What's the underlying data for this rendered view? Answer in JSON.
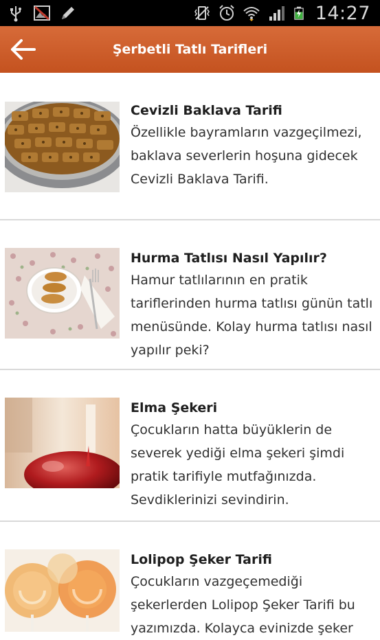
{
  "status_bar": {
    "left_icons": [
      "usb-icon",
      "blocked-image-icon",
      "pencil-icon"
    ],
    "right_icons": [
      "vibrate-icon",
      "alarm-icon",
      "wifi-icon",
      "signal-icon",
      "battery-charging-icon"
    ],
    "time": "14:27"
  },
  "action_bar": {
    "title": "Şerbetli Tatlı Tarifleri",
    "back_icon": "arrow-left-icon",
    "color": "#cf5f2c"
  },
  "recipes": [
    {
      "title": "Cevizli Baklava Tarifi",
      "description": "Özellikle bayramların vazgeçilmezi, baklava severlerin hoşuna gidecek Cevizli Baklava Tarifi.",
      "image": "baklava-photo"
    },
    {
      "title": "Hurma Tatlısı Nasıl Yapılır?",
      "description": "Hamur tatlılarının en pratik tariflerinden hurma tatlısı günün tatlı menüsünde. Kolay hurma tatlısı nasıl yapılır peki?",
      "image": "hurma-tatlisi-photo"
    },
    {
      "title": "Elma Şekeri",
      "description": "Çocukların hatta büyüklerin de severek yediği elma şekeri şimdi pratik tarifiyle mutfağınızda. Sevdiklerinizi sevindirin.",
      "image": "elma-sekeri-photo"
    },
    {
      "title": "Lolipop Şeker Tarifi",
      "description": "Çocukların vazgeçemediği şekerlerden Lolipop Şeker Tarifi bu yazımızda. Kolayca evinizde şeker",
      "image": "lolipop-photo"
    }
  ]
}
